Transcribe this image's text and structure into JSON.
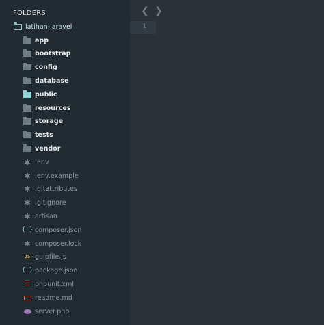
{
  "sidebar": {
    "title": "FOLDERS",
    "root": {
      "label": "latihan-laravel",
      "icon": "folder-open-icon"
    },
    "folders": [
      {
        "label": "app",
        "icon": "folder-icon"
      },
      {
        "label": "bootstrap",
        "icon": "folder-icon"
      },
      {
        "label": "config",
        "icon": "folder-icon"
      },
      {
        "label": "database",
        "icon": "folder-icon"
      },
      {
        "label": "public",
        "icon": "folder-icon",
        "highlighted": true
      },
      {
        "label": "resources",
        "icon": "folder-icon"
      },
      {
        "label": "storage",
        "icon": "folder-icon"
      },
      {
        "label": "tests",
        "icon": "folder-icon"
      },
      {
        "label": "vendor",
        "icon": "folder-icon"
      }
    ],
    "files": [
      {
        "label": ".env",
        "icon": "asterisk-icon",
        "glyph": "✱"
      },
      {
        "label": ".env.example",
        "icon": "asterisk-icon",
        "glyph": "✱"
      },
      {
        "label": ".gitattributes",
        "icon": "asterisk-icon",
        "glyph": "✱"
      },
      {
        "label": ".gitignore",
        "icon": "asterisk-icon",
        "glyph": "✱"
      },
      {
        "label": "artisan",
        "icon": "asterisk-icon",
        "glyph": "✱"
      },
      {
        "label": "composer.json",
        "icon": "json-braces-icon",
        "glyph": "{ }"
      },
      {
        "label": "composer.lock",
        "icon": "asterisk-icon",
        "glyph": "✱"
      },
      {
        "label": "gulpfile.js",
        "icon": "js-icon",
        "glyph": "JS"
      },
      {
        "label": "package.json",
        "icon": "json-braces-icon",
        "glyph": "{ }"
      },
      {
        "label": "phpunit.xml",
        "icon": "xml-icon",
        "glyph": "☰"
      },
      {
        "label": "readme.md",
        "icon": "markdown-icon",
        "glyph": ""
      },
      {
        "label": "server.php",
        "icon": "php-icon",
        "glyph": ""
      }
    ]
  },
  "editor": {
    "nav": {
      "back_glyph": "❮",
      "forward_glyph": "❯"
    },
    "line_number": "1"
  },
  "colors": {
    "sidebar_bg": "#212b31",
    "editor_bg": "#2a3137",
    "accent": "#8fc7c9"
  }
}
